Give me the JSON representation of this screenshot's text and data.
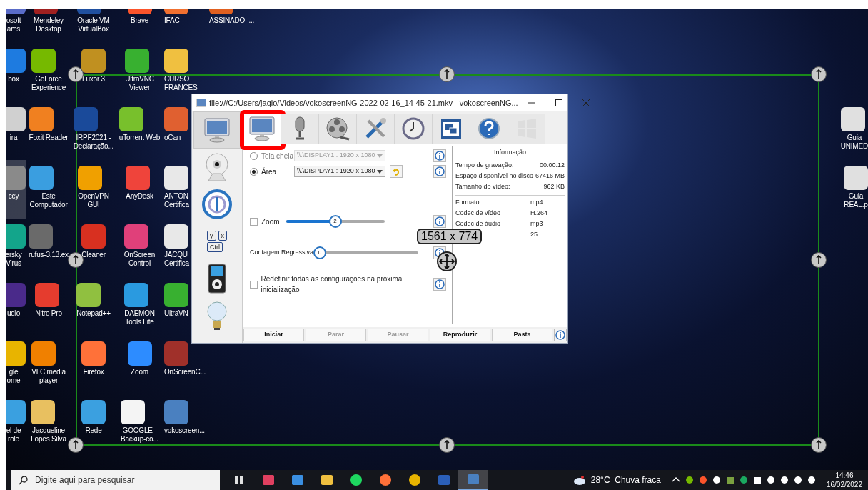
{
  "desktop": {
    "columns": [
      {
        "items": [
          {
            "label": "osoft\nams",
            "color": "#5a6cc8",
            "selected": false
          },
          {
            "label": "box",
            "color": "#1e7be0",
            "selected": false
          },
          {
            "label": "ira",
            "color": "#d0d0d0",
            "selected": false
          },
          {
            "label": "ccy",
            "color": "#8a8a8a",
            "selected": true
          },
          {
            "label": "ersky\nVirus",
            "color": "#13a58b",
            "selected": false
          },
          {
            "label": "udio",
            "color": "#4a2a8a",
            "selected": false
          },
          {
            "label": "gle\nome",
            "color": "#e8b400",
            "selected": false
          },
          {
            "label": "el de\nrole",
            "color": "#3aa0e0",
            "selected": false
          }
        ]
      },
      {
        "items": [
          {
            "label": "Mendeley\nDesktop",
            "color": "#a02020",
            "selected": false
          },
          {
            "label": "GeForce\nExperience",
            "color": "#76b900",
            "selected": false
          },
          {
            "label": "Foxit Reader",
            "color": "#f08020",
            "selected": false
          },
          {
            "label": "Este\nComputador",
            "color": "#3a9ee0",
            "selected": false
          },
          {
            "label": "rufus-3.13.ex",
            "color": "#6a6a6a",
            "selected": false
          },
          {
            "label": "Nitro Pro",
            "color": "#e53c2e",
            "selected": false
          },
          {
            "label": "VLC media\nplayer",
            "color": "#f08000",
            "selected": false
          },
          {
            "label": "Jacqueline\nLopes Silva",
            "color": "#e8c060",
            "selected": false
          }
        ]
      },
      {
        "items": [
          {
            "label": "Oracle VM\nVirtualBox",
            "color": "#2050a0",
            "selected": false
          },
          {
            "label": "Luxor 3",
            "color": "#c09020",
            "selected": false
          },
          {
            "label": "IRPF2021 -\nDeclaração...",
            "color": "#1a4a9a",
            "selected": false
          },
          {
            "label": "OpenVPN\nGUI",
            "color": "#f0a000",
            "selected": false
          },
          {
            "label": "Cleaner",
            "color": "#d83020",
            "selected": false
          },
          {
            "label": "Notepad++",
            "color": "#90c040",
            "selected": false
          },
          {
            "label": "Firefox",
            "color": "#ff7139",
            "selected": false
          },
          {
            "label": "Rede",
            "color": "#3ba0e0",
            "selected": false
          }
        ]
      },
      {
        "items": [
          {
            "label": "Brave",
            "color": "#fb542b",
            "selected": false
          },
          {
            "label": "UltraVNC\nViewer",
            "color": "#38b030",
            "selected": false
          },
          {
            "label": "uTorrent Web",
            "color": "#78c02c",
            "selected": false
          },
          {
            "label": "AnyDesk",
            "color": "#ef443b",
            "selected": false
          },
          {
            "label": "OnScreen\nControl",
            "color": "#e0407a",
            "selected": false
          },
          {
            "label": "DAEMON\nTools Lite",
            "color": "#2a9ae0",
            "selected": false
          },
          {
            "label": "Zoom",
            "color": "#2d8cff",
            "selected": false
          },
          {
            "label": "GOOGLE -\nBackup-co...",
            "color": "#f4f4f4",
            "selected": false
          }
        ]
      },
      {
        "items": [
          {
            "label": "IFAC",
            "color": "#f07030",
            "selected": false
          },
          {
            "label": "CURSO\nFRANCES",
            "color": "#f0c040",
            "selected": false
          },
          {
            "label": "oCan",
            "color": "#e06030",
            "selected": false
          },
          {
            "label": "ANTON\nCertifica",
            "color": "#e8e8e8",
            "selected": false
          },
          {
            "label": "JACQU\nCertifica",
            "color": "#e8e8e8",
            "selected": false
          },
          {
            "label": "UltraVN",
            "color": "#38b030",
            "selected": false
          },
          {
            "label": "OnScreenC...",
            "color": "#a0302a",
            "selected": false
          },
          {
            "label": "vokoscreen...",
            "color": "#4a80c0",
            "selected": false
          }
        ]
      },
      {
        "items": [
          {
            "label": "ASSINADO_...",
            "color": "#e06020",
            "selected": false
          }
        ]
      }
    ],
    "right_items": [
      {
        "label": "Guia\nUNIMED",
        "color": "#e0e0e0",
        "selected": false
      },
      {
        "label": "Guia\nREAL.p",
        "color": "#e0e0e0",
        "selected": false
      }
    ]
  },
  "selection": {
    "size_label": "1561 x 774"
  },
  "window": {
    "title": "file:///C:/Users/jaqlo/Videos/vokoscreenNG-2022-02-16_14-45-21.mkv - vokoscreenNG...",
    "side_tabs": [
      {
        "kind": "monitor",
        "selected": true
      },
      {
        "kind": "webcam",
        "selected": false
      },
      {
        "kind": "logo",
        "selected": false
      },
      {
        "kind": "keys",
        "selected": false,
        "keys": [
          "y",
          "x",
          "Ctrl"
        ]
      },
      {
        "kind": "player",
        "selected": false
      },
      {
        "kind": "bulb",
        "selected": false
      }
    ],
    "top_tabs": [
      {
        "kind": "monitor",
        "selected": true,
        "annotated": true
      },
      {
        "kind": "mic",
        "selected": false,
        "annotated": false
      },
      {
        "kind": "film",
        "selected": false,
        "annotated": false
      },
      {
        "kind": "tools",
        "selected": false,
        "annotated": false
      },
      {
        "kind": "clock",
        "selected": false,
        "annotated": false
      },
      {
        "kind": "window",
        "selected": false,
        "annotated": false
      },
      {
        "kind": "help",
        "selected": false,
        "annotated": false
      },
      {
        "kind": "winlogo",
        "selected": false,
        "annotated": false
      }
    ],
    "capture_modes": [
      {
        "label": "Tela cheia",
        "selected": false,
        "display": "\\\\.\\DISPLAY1 :  1920 x 1080",
        "disabled": true
      },
      {
        "label": "Área",
        "selected": true,
        "display": "\\\\.\\DISPLAY1 :  1920 x 1080",
        "disabled": false
      }
    ],
    "zoom": {
      "label": "Zoom",
      "checked": false,
      "level": 0.5,
      "value": "2"
    },
    "countdown": {
      "label": "Contagem Regressiva",
      "level": 0,
      "value": "0"
    },
    "reset": {
      "label": "Redefinir todas as configurações na próxima inicialização",
      "checked": false
    },
    "info": {
      "title": "Informação",
      "rows": [
        {
          "label": "Tempo de gravação:",
          "value": "00:00:12"
        },
        {
          "label": "Espaço disponível no disco",
          "value": "67416 MB"
        },
        {
          "label": "Tamanho do vídeo:",
          "value": "962 KB"
        }
      ],
      "format_rows": [
        {
          "label": "Formato",
          "value": "mp4"
        },
        {
          "label": "Codec de vídeo",
          "value": "H.264"
        },
        {
          "label": "Codec de áudio",
          "value": "mp3"
        },
        {
          "value": "25"
        }
      ]
    },
    "buttons": [
      {
        "label": "Iniciar",
        "disabled": false
      },
      {
        "label": "Parar",
        "disabled": true
      },
      {
        "label": "Pausar",
        "disabled": true
      },
      {
        "label": "Reproduzir",
        "disabled": false
      },
      {
        "label": "Pasta",
        "disabled": false
      }
    ]
  },
  "taskbar": {
    "search_placeholder": "Digite aqui para pesquisar",
    "apps": [
      {
        "kind": "taskview",
        "color": "#e0e0e0",
        "active": false
      },
      {
        "kind": "snip",
        "color": "#e04060",
        "active": false
      },
      {
        "kind": "store",
        "color": "#3a8ee0",
        "active": false
      },
      {
        "kind": "folder",
        "color": "#f0c040",
        "active": false
      },
      {
        "kind": "spotify",
        "color": "#1ed760",
        "active": false
      },
      {
        "kind": "firefox",
        "color": "#ff7139",
        "active": false
      },
      {
        "kind": "chrome",
        "color": "#e8b400",
        "active": false
      },
      {
        "kind": "word",
        "color": "#2b5fb8",
        "active": false
      },
      {
        "kind": "vokoscreen",
        "color": "#4a80c0",
        "active": true
      }
    ],
    "weather": "28°C  Chuva fraca",
    "tray": [
      {
        "kind": "chevron",
        "color": "#ffffff"
      },
      {
        "kind": "dot",
        "color": "#76b900"
      },
      {
        "kind": "dot",
        "color": "#fb542b"
      },
      {
        "kind": "dot",
        "color": "#ffffff"
      },
      {
        "kind": "square",
        "color": "#7aa040"
      },
      {
        "kind": "dot",
        "color": "#1aa860"
      },
      {
        "kind": "square",
        "color": "#ffffff"
      },
      {
        "kind": "dot",
        "color": "#ffffff"
      },
      {
        "kind": "dot",
        "color": "#ffffff"
      },
      {
        "kind": "dot",
        "color": "#ffffff"
      },
      {
        "kind": "dot",
        "color": "#ffffff"
      }
    ],
    "time": "14:46",
    "date": "16/02/2022"
  }
}
